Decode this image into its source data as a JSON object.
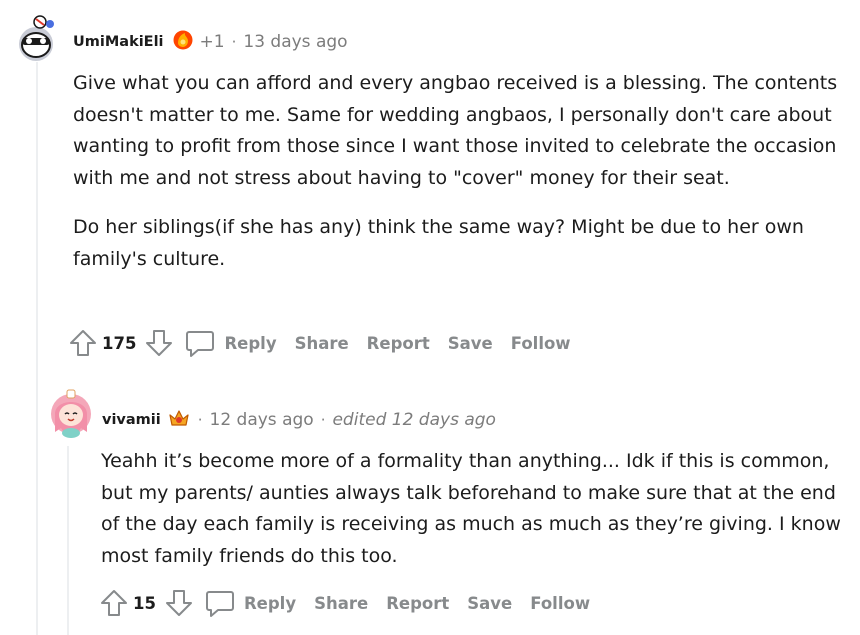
{
  "comments": [
    {
      "username": "UmiMakiEli",
      "award_count": "+1",
      "separator": "·",
      "timestamp": "13 days ago",
      "paragraphs": [
        "Give what you can afford and every angbao received is a blessing. The contents doesn't matter to me. Same for wedding angbaos, I personally don't care about wanting to profit from those since I want those invited to celebrate the occasion with me and not stress about having to \"cover\" money for their seat.",
        "Do her siblings(if she has any) think the same way? Might be due to her own family's culture."
      ],
      "score": "175",
      "actions": [
        "Reply",
        "Share",
        "Report",
        "Save",
        "Follow"
      ]
    },
    {
      "username": "vivamii",
      "separator": "·",
      "timestamp": "12 days ago",
      "edited": "edited 12 days ago",
      "paragraphs": [
        "Yeahh it’s become more of a formality than anything... Idk if this is common, but my parents/ aunties always talk beforehand to make sure that at the end of the day each family is receiving as much as much as they’re giving. I know most family friends do this too."
      ],
      "score": "15",
      "actions": [
        "Reply",
        "Share",
        "Report",
        "Save",
        "Follow"
      ]
    }
  ]
}
